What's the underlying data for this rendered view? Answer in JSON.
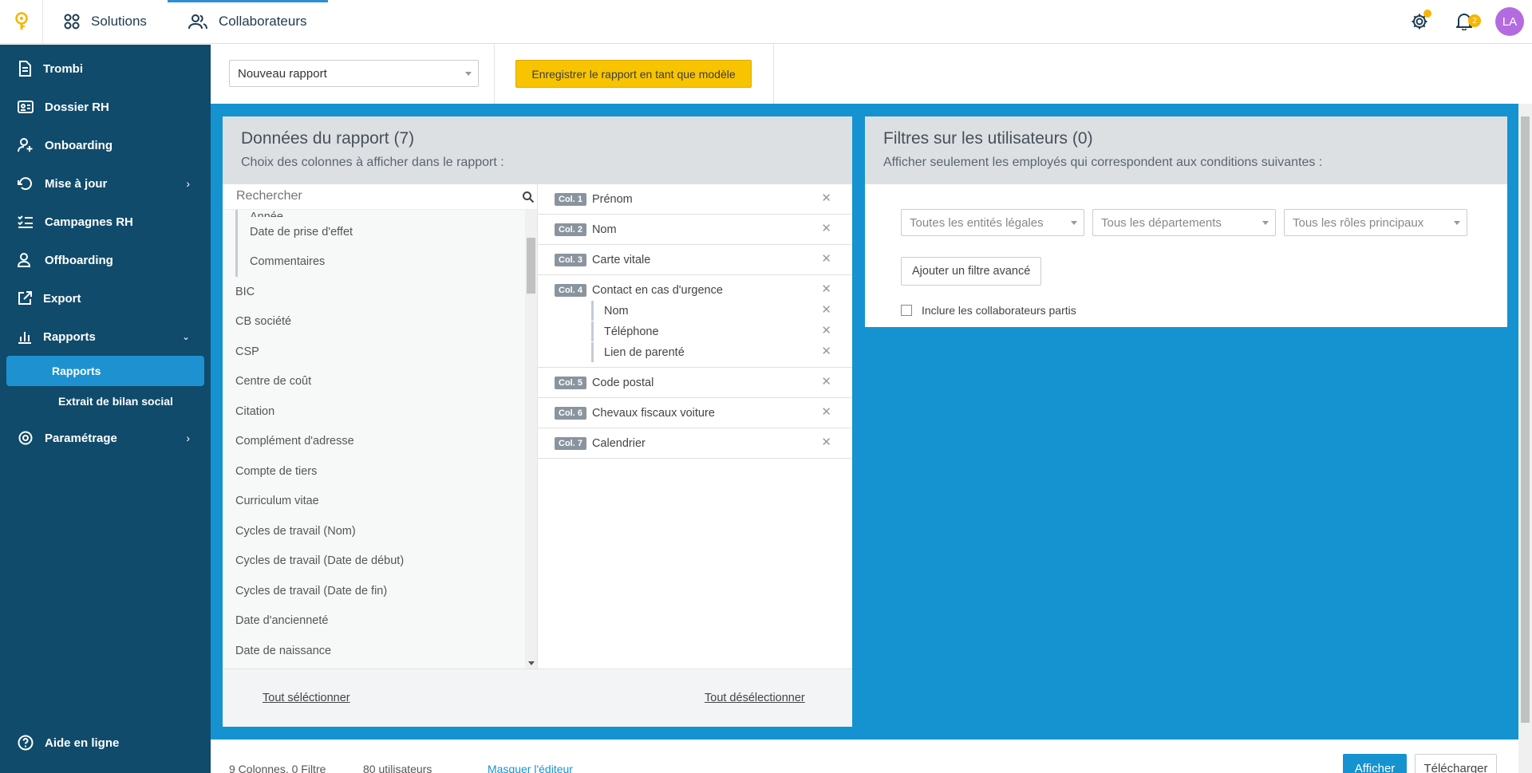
{
  "topbar": {
    "solutions_label": "Solutions",
    "collaborateurs_label": "Collaborateurs",
    "notif_count": "2",
    "avatar_initials": "LA"
  },
  "sidebar": {
    "items": [
      {
        "label": "Trombi",
        "icon": "document-icon"
      },
      {
        "label": "Dossier RH",
        "icon": "id-card-icon"
      },
      {
        "label": "Onboarding",
        "icon": "user-plus-icon"
      },
      {
        "label": "Mise à jour",
        "icon": "refresh-icon"
      },
      {
        "label": "Campagnes RH",
        "icon": "checklist-icon"
      },
      {
        "label": "Offboarding",
        "icon": "user-minus-icon"
      },
      {
        "label": "Export",
        "icon": "external-link-icon"
      },
      {
        "label": "Rapports",
        "icon": "bar-chart-icon"
      }
    ],
    "sub_items": [
      "Rapports",
      "Extrait de bilan social"
    ],
    "parametrage_label": "Paramétrage",
    "help_label": "Aide en ligne"
  },
  "toolbar": {
    "report_select_value": "Nouveau rapport",
    "save_template_label": "Enregistrer le rapport en tant que modèle"
  },
  "report_data": {
    "title": "Données du rapport (7)",
    "subtitle": "Choix des colonnes à afficher dans le rapport :",
    "search_placeholder": "Rechercher",
    "cut_item": "Année",
    "available_children": [
      "Date de prise d'effet",
      "Commentaires"
    ],
    "available": [
      "BIC",
      "CB société",
      "CSP",
      "Centre de coût",
      "Citation",
      "Complément d'adresse",
      "Compte de tiers",
      "Curriculum vitae",
      "Cycles de travail (Nom)",
      "Cycles de travail (Date de début)",
      "Cycles de travail (Date de fin)",
      "Date d'ancienneté",
      "Date de naissance"
    ],
    "selected": [
      {
        "badge": "Col. 1",
        "label": "Prénom",
        "children": []
      },
      {
        "badge": "Col. 2",
        "label": "Nom",
        "children": []
      },
      {
        "badge": "Col. 3",
        "label": "Carte vitale",
        "children": []
      },
      {
        "badge": "Col. 4",
        "label": "Contact en cas d'urgence",
        "children": [
          "Nom",
          "Téléphone",
          "Lien de parenté"
        ]
      },
      {
        "badge": "Col. 5",
        "label": "Code postal",
        "children": []
      },
      {
        "badge": "Col. 6",
        "label": "Chevaux fiscaux voiture",
        "children": []
      },
      {
        "badge": "Col. 7",
        "label": "Calendrier",
        "children": []
      }
    ],
    "remove_glyph": "✕",
    "select_all_label": "Tout séléctionner",
    "deselect_all_label": "Tout désélectionner"
  },
  "filters": {
    "title": "Filtres sur les utilisateurs (0)",
    "subtitle": "Afficher seulement les employés qui correspondent aux conditions suivantes :",
    "legal_entities": "Toutes les entités légales",
    "departments": "Tous les départements",
    "roles": "Tous les rôles principaux",
    "advanced_label": "Ajouter un filtre avancé",
    "include_left_label": "Inclure les collaborateurs partis"
  },
  "bottom": {
    "summary": "9 Colonnes, 0 Filtre",
    "users": "80 utilisateurs",
    "hide_editor": "Masquer l'éditeur",
    "show_label": "Afficher",
    "download_label": "Télécharger"
  },
  "colors": {
    "sidebar_bg": "#104b6b",
    "accent_blue": "#1592d0",
    "yellow": "#f8c400",
    "avatar": "#b46be0"
  }
}
